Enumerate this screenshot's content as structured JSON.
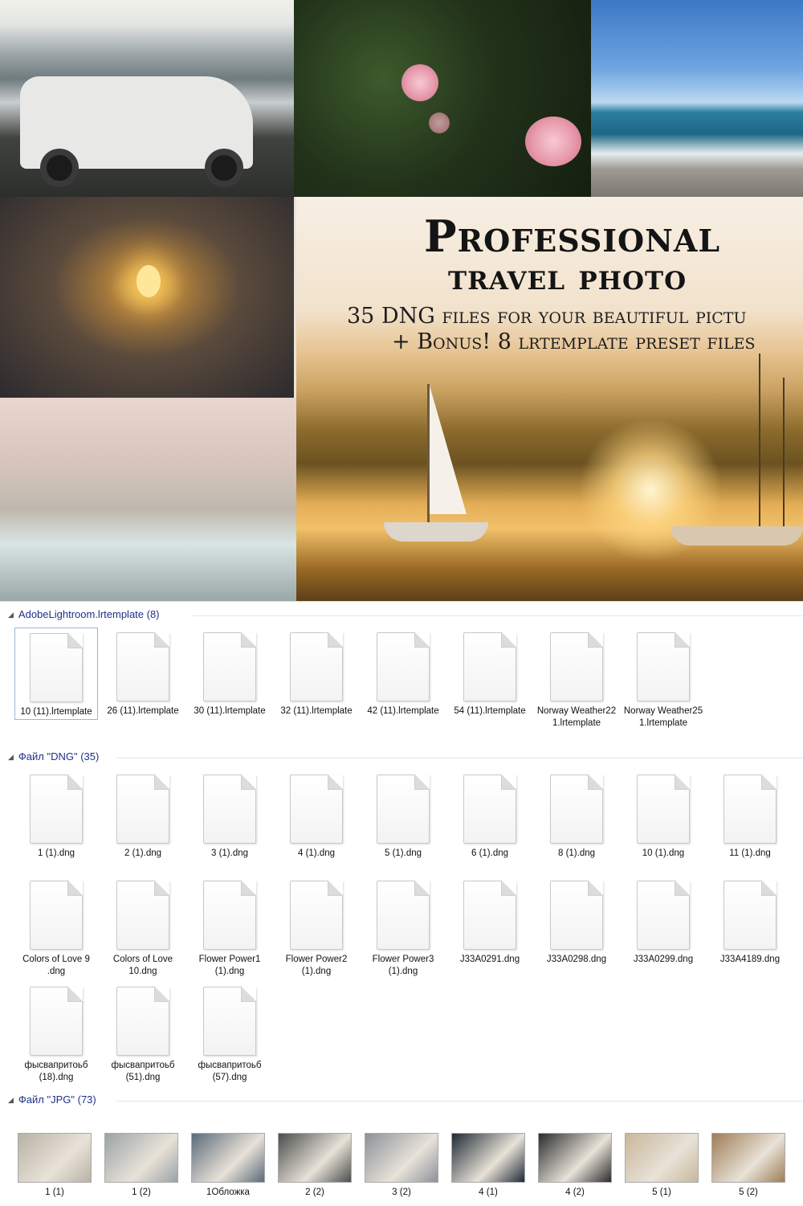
{
  "banner": {
    "title": "Professional",
    "subtitle": "travel photo",
    "line1": "35 DNG files for your beautiful pictu",
    "line2": "+ Bonus! 8 lrtemplate preset files"
  },
  "groups": [
    {
      "header": "AdobeLightroom.lrtemplate (8)",
      "items": [
        "10 (11).lrtemplate",
        "26 (11).lrtemplate",
        "30 (11).lrtemplate",
        "32 (11).lrtemplate",
        "42 (11).lrtemplate",
        "54 (11).lrtemplate",
        "Norway Weather22 1.lrtemplate",
        "Norway Weather25 1.lrtemplate"
      ]
    },
    {
      "header": "Файл \"DNG\" (35)",
      "items": [
        "1 (1).dng",
        "2 (1).dng",
        "3 (1).dng",
        "4 (1).dng",
        "5 (1).dng",
        "6 (1).dng",
        "8 (1).dng",
        "10 (1).dng",
        "11 (1).dng",
        "Colors of Love 9 .dng",
        "Colors of Love 10.dng",
        "Flower Power1 (1).dng",
        "Flower Power2 (1).dng",
        "Flower Power3 (1).dng",
        "J33A0291.dng",
        "J33A0298.dng",
        "J33A0299.dng",
        "J33A4189.dng",
        "фысвапритоьб (18).dng",
        "фысвапритоьб (51).dng",
        "фысвапритоьб (57).dng"
      ]
    },
    {
      "header": "Файл \"JPG\" (73)",
      "items": [
        "1 (1)",
        "1 (2)",
        "1Обложка",
        "2 (2)",
        "3 (2)",
        "4 (1)",
        "4 (2)",
        "5 (1)",
        "5 (2)"
      ]
    }
  ],
  "thumb_colors": [
    "#b8b2a6",
    "#9aa3a7",
    "#5b6b7a",
    "#4a4e4c",
    "#8c9299",
    "#1f2a36",
    "#2a2c2e",
    "#c9b79a",
    "#9e7d56"
  ],
  "colors": {
    "group_header": "#1e3287",
    "selection_border": "#98b7d9"
  }
}
